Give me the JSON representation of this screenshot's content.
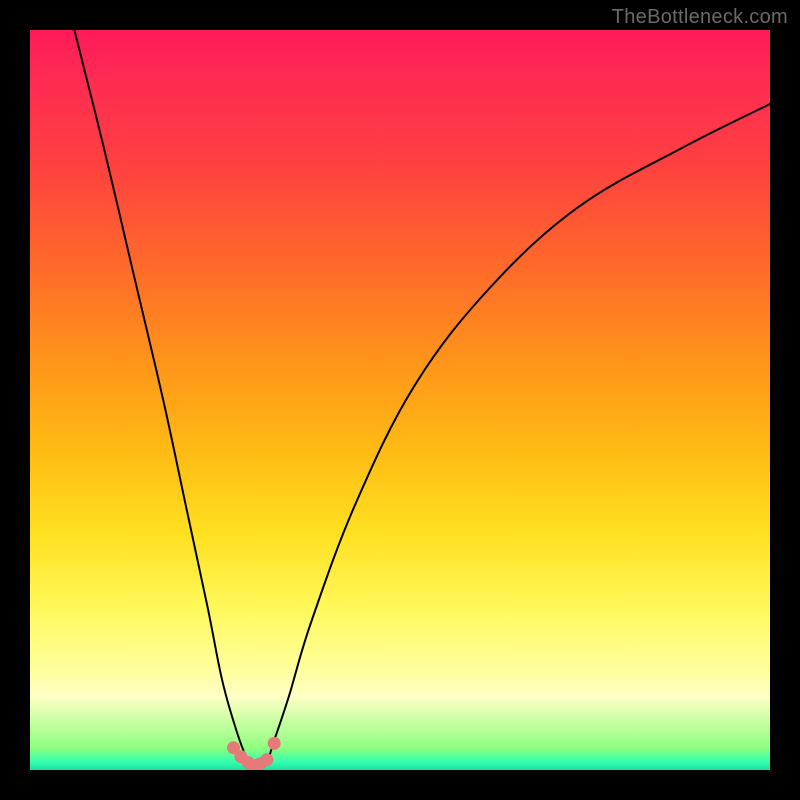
{
  "watermark": "TheBottleneck.com",
  "chart_data": {
    "type": "line",
    "title": "",
    "xlabel": "",
    "ylabel": "",
    "xlim": [
      0,
      100
    ],
    "ylim": [
      0,
      100
    ],
    "legend": false,
    "grid": false,
    "series": [
      {
        "name": "bottleneck-curve",
        "x": [
          6,
          10,
          14,
          18,
          21,
          24,
          26,
          28,
          29.5,
          30,
          31,
          32,
          33,
          35,
          38,
          44,
          52,
          62,
          74,
          88,
          100
        ],
        "values": [
          100,
          84,
          67,
          50,
          36,
          22,
          12,
          5,
          1,
          0,
          0,
          1,
          4,
          10,
          20,
          36,
          52,
          65,
          76,
          84,
          90
        ]
      }
    ],
    "markers": {
      "name": "highlight-dots",
      "x": [
        27.5,
        28.5,
        29.5,
        30.0,
        31.0,
        32.0,
        33.0
      ],
      "values": [
        3.0,
        1.8,
        1.0,
        0.6,
        0.8,
        1.4,
        3.6
      ]
    },
    "background_gradient": {
      "direction": "vertical",
      "stops": [
        {
          "pos": 0.0,
          "color": "#ff1a58"
        },
        {
          "pos": 0.18,
          "color": "#ff4040"
        },
        {
          "pos": 0.45,
          "color": "#ff951a"
        },
        {
          "pos": 0.68,
          "color": "#ffe020"
        },
        {
          "pos": 0.86,
          "color": "#ffff9a"
        },
        {
          "pos": 0.97,
          "color": "#8fff80"
        },
        {
          "pos": 1.0,
          "color": "#1fe09f"
        }
      ]
    }
  }
}
